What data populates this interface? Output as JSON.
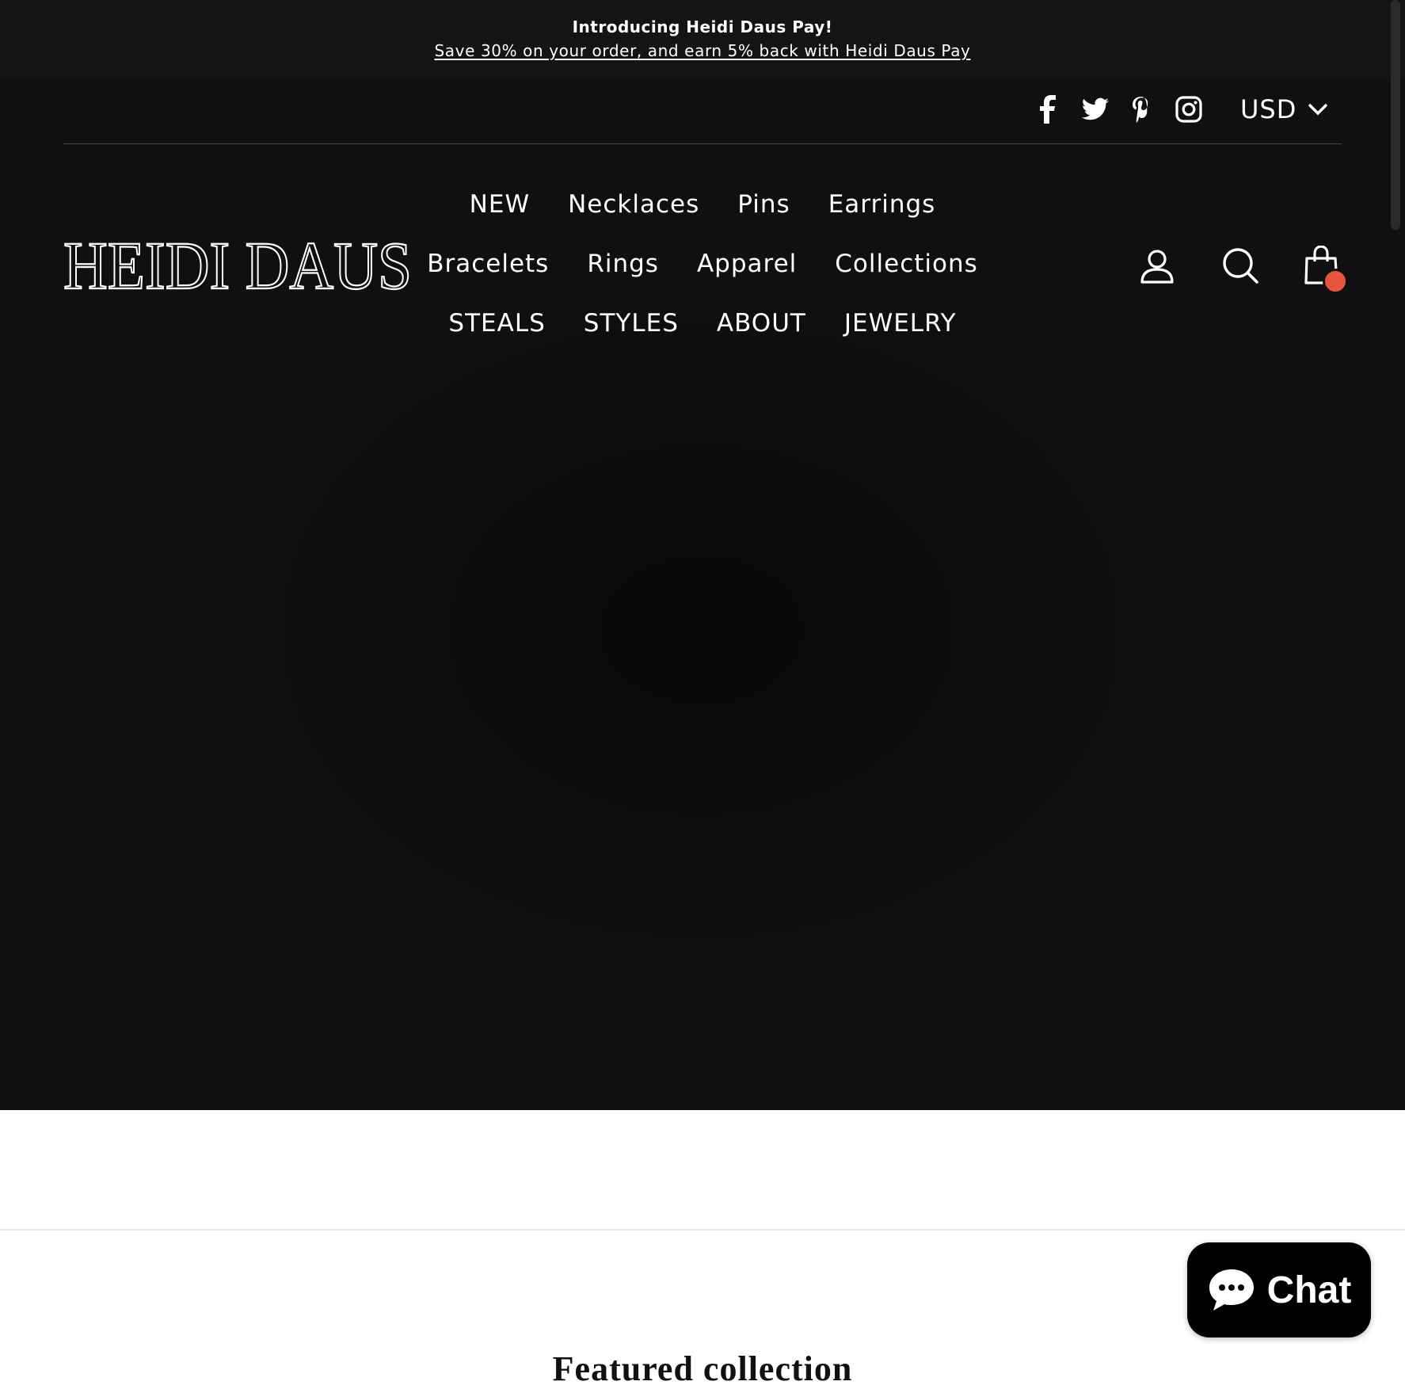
{
  "announcement": {
    "title": "Introducing Heidi Daus Pay!",
    "link_text": "Save 30% on your order, and earn 5% back with Heidi Daus Pay"
  },
  "header": {
    "social_icons": [
      "facebook-icon",
      "twitter-icon",
      "pinterest-icon",
      "instagram-icon"
    ],
    "currency": "USD",
    "logo_text": "HEIDI DAUS",
    "nav": {
      "row1": [
        "NEW",
        "Necklaces",
        "Pins",
        "Earrings"
      ],
      "row2": [
        "Bracelets",
        "Rings",
        "Apparel",
        "Collections"
      ],
      "row3": [
        "STEALS",
        "STYLES",
        "ABOUT",
        "JEWELRY"
      ]
    },
    "actions": [
      "user-icon",
      "search-icon",
      "cart-icon"
    ]
  },
  "colors": {
    "announcement_bg": "#141414",
    "hero_bg": "#101010",
    "cart_badge": "#e8553e",
    "chat_bg": "#000000"
  },
  "section": {
    "featured_title": "Featured collection"
  },
  "chat": {
    "label": "Chat"
  }
}
